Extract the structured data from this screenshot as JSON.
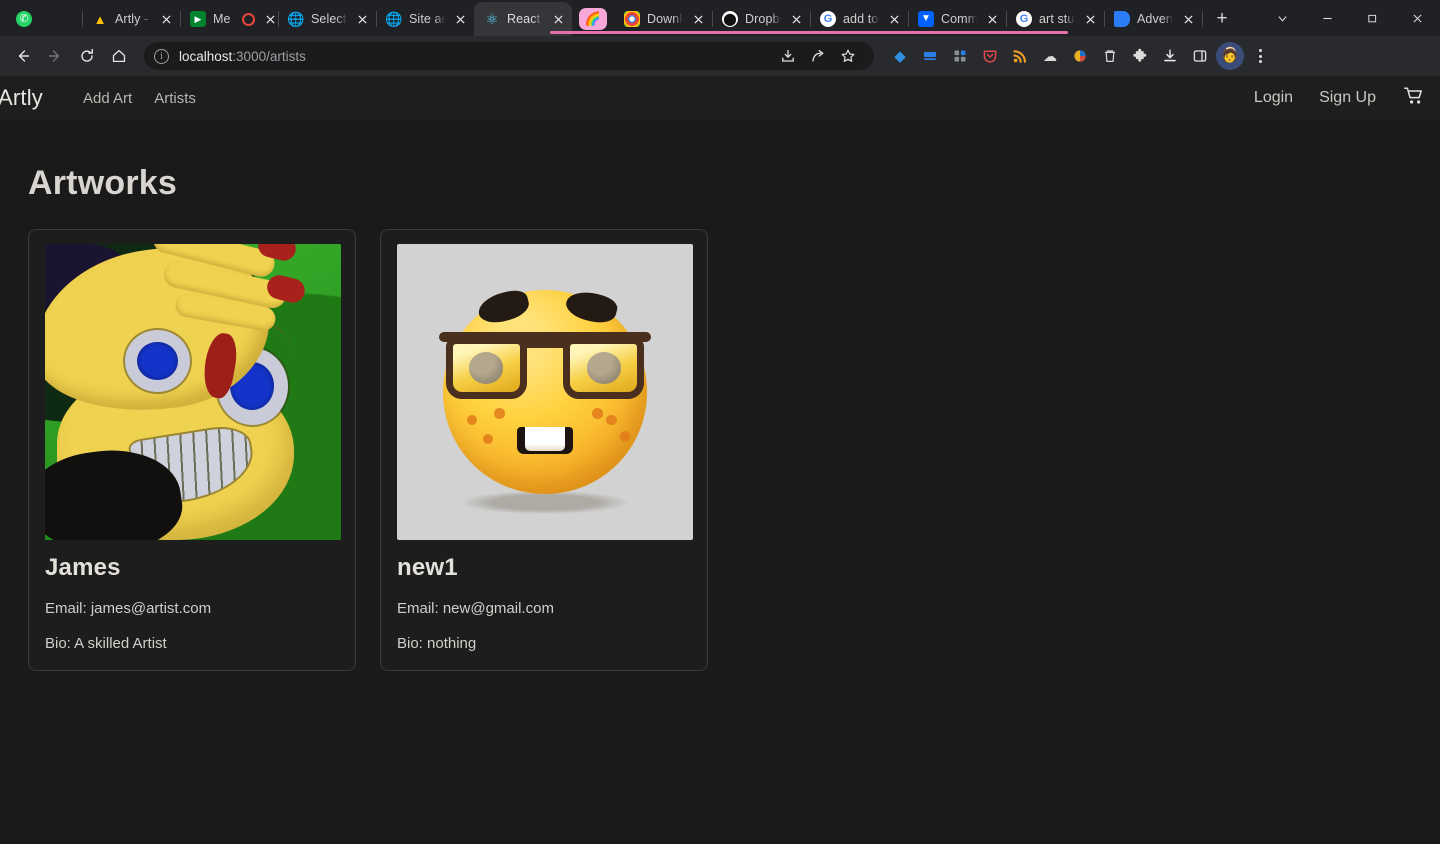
{
  "browser": {
    "tabs": [
      {
        "title": "",
        "favicon": "whatsapp-icon",
        "glyph": "✆",
        "pinned": false,
        "active": false,
        "narrow": true
      },
      {
        "title": "Artly -",
        "favicon": "google-drive-icon",
        "glyph": "▲",
        "pinned": false,
        "active": false
      },
      {
        "title": "Me",
        "favicon": "google-meet-icon",
        "glyph": "▣",
        "pinned": false,
        "active": false,
        "extra": "record-dot"
      },
      {
        "title": "Select a",
        "favicon": "globe-icon",
        "glyph": "🌐",
        "pinned": false,
        "active": false
      },
      {
        "title": "Site ad",
        "favicon": "globe-icon",
        "glyph": "🌐",
        "pinned": false,
        "active": false
      },
      {
        "title": "React A",
        "favicon": "react-icon",
        "glyph": "⚛",
        "pinned": false,
        "active": true
      },
      {
        "title": "",
        "favicon": "rainbow-icon",
        "glyph": "🌈",
        "pinned": true,
        "active": false
      },
      {
        "title": "Downlo",
        "favicon": "chrome-icon",
        "glyph": "◎",
        "pinned": false,
        "active": false
      },
      {
        "title": "Dropbo",
        "favicon": "github-icon",
        "glyph": "",
        "pinned": false,
        "active": false
      },
      {
        "title": "add to",
        "favicon": "google-icon",
        "glyph": "G",
        "pinned": false,
        "active": false
      },
      {
        "title": "Comm",
        "favicon": "dropbox-icon",
        "glyph": "▼",
        "pinned": false,
        "active": false
      },
      {
        "title": "art stu",
        "favicon": "google-icon",
        "glyph": "G",
        "pinned": false,
        "active": false
      },
      {
        "title": "Advent",
        "favicon": "blue-doc-icon",
        "glyph": "◗",
        "pinned": false,
        "active": false
      }
    ],
    "new_tab_label": "+",
    "window_controls": {
      "tab_search": "chevron-down-icon",
      "minimize": "minimize-icon",
      "maximize": "maximize-icon",
      "close": "close-icon"
    },
    "toolbar": {
      "back": "back-arrow-icon",
      "forward": "forward-arrow-icon",
      "reload": "reload-icon",
      "home": "home-icon",
      "site_info": "info-icon",
      "url_host": "localhost",
      "url_path": ":3000/artists",
      "install": "install-icon",
      "share": "share-icon",
      "bookmark": "star-icon",
      "extensions": [
        {
          "name": "diamond-extension-icon",
          "glyph": "◆",
          "color": "#2f8fe0"
        },
        {
          "name": "screen-extension-icon",
          "glyph": "▬",
          "color": "#2a7fe6"
        },
        {
          "name": "grid-extension-icon",
          "glyph": "▦",
          "color": "#8a8f96"
        },
        {
          "name": "pocket-extension-icon",
          "glyph": "⛊",
          "color": "#e0464e"
        },
        {
          "name": "rss-extension-icon",
          "glyph": "≋",
          "color": "#f0a026"
        },
        {
          "name": "cloud-extension-icon",
          "glyph": "☁",
          "color": "#dcdcdc"
        },
        {
          "name": "pie-chart-extension-icon",
          "glyph": "◕",
          "color": "#e8b220"
        },
        {
          "name": "trash-extension-icon",
          "glyph": "🗑",
          "color": "#d8d8d8"
        },
        {
          "name": "puzzle-extensions-icon",
          "glyph": "🧩",
          "color": "#dcdcdc"
        },
        {
          "name": "downloads-icon",
          "glyph": "⤓",
          "color": "#e4e4e4"
        },
        {
          "name": "side-panel-icon",
          "glyph": "▢",
          "color": "#e4e4e4"
        }
      ],
      "profile": "profile-avatar",
      "menu": "three-dot-menu-icon"
    }
  },
  "site": {
    "brand": "Artly",
    "nav_links": [
      {
        "label": "Add Art"
      },
      {
        "label": "Artists"
      }
    ],
    "auth_links": [
      {
        "label": "Login"
      },
      {
        "label": "Sign Up"
      }
    ],
    "cart_icon": "shopping-cart-icon",
    "page_title": "Artworks",
    "cards": [
      {
        "name": "James",
        "email": "Email: james@artist.com",
        "bio": "Bio: A skilled Artist",
        "image_alt": "green-haired-cartoon-face-artwork"
      },
      {
        "name": "new1",
        "email": "Email: new@gmail.com",
        "bio": "Bio: nothing",
        "image_alt": "nerd-face-emoji-artwork"
      }
    ]
  },
  "colors": {
    "page_bg": "#1a1a1a",
    "chrome_bg": "#202124",
    "toolbar_bg": "#292a2d",
    "omnibox_bg": "#1b1b1b",
    "card_border": "#3a3a3a",
    "tab_group_pink": "#e86fae",
    "text_primary": "#e3e0db",
    "text_muted": "#b9b5b0"
  }
}
